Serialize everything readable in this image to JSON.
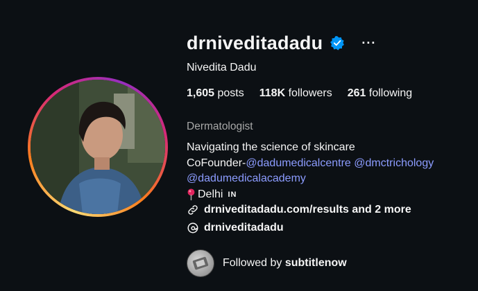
{
  "profile": {
    "username": "drniveditadadu",
    "more_label": "···",
    "full_name": "Nivedita Dadu",
    "stats": {
      "posts_count": "1,605",
      "posts_label": "posts",
      "followers_count": "118K",
      "followers_label": "followers",
      "following_count": "261",
      "following_label": "following"
    },
    "category": "Dermatologist",
    "bio": {
      "line1": "Navigating the science of skincare",
      "line2_prefix": "CoFounder-",
      "mention1": "@dadumedicalcentre",
      "mention2": "@dmctrichology",
      "mention3": "@dadumedicalacademy",
      "location": "Delhi",
      "country_code": "IN"
    },
    "links": {
      "website": "drniveditadadu.com/results and 2 more",
      "threads": "drniveditadadu"
    },
    "followed_by": {
      "prefix": "Followed by",
      "user": "subtitlenow"
    }
  },
  "colors": {
    "background": "#0c1014",
    "verified": "#0095f6",
    "mention": "#8c9cff",
    "muted": "#a8a8a8"
  },
  "icons": [
    "verified-badge-icon",
    "more-options-icon",
    "location-pin-icon",
    "link-icon",
    "threads-icon"
  ]
}
